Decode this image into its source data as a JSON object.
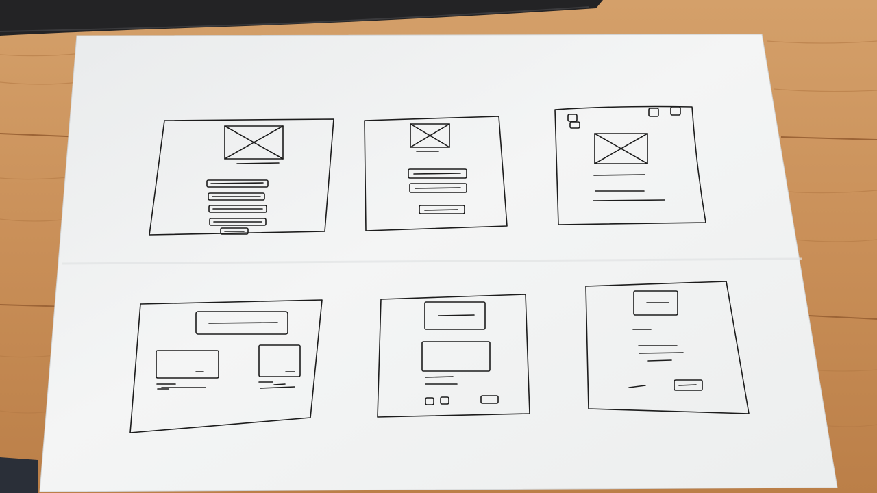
{
  "scene": {
    "subject": "",
    "colors": {
      "wood_light": "#d9a56e",
      "wood_mid": "#c88c55",
      "wood_dark": "#a86b3a",
      "laptop": "#232325",
      "paper": "#f2f3f3",
      "paper_shadow": "#dcdedf",
      "ink": "#1c1c1c"
    }
  },
  "wireframes": [
    {
      "id": 1,
      "elements": [
        "image-placeholder",
        "caption-line",
        "list-bar",
        "list-bar",
        "list-bar",
        "list-bar",
        "small-button"
      ]
    },
    {
      "id": 2,
      "elements": [
        "image-placeholder",
        "caption-line",
        "list-bar",
        "list-bar",
        "small-button"
      ]
    },
    {
      "id": 3,
      "elements": [
        "corner-icon",
        "corner-icon",
        "corner-icon",
        "image-placeholder",
        "text-line",
        "text-line",
        "text-line"
      ]
    },
    {
      "id": 4,
      "elements": [
        "header-bar",
        "card",
        "card",
        "text-line",
        "text-line"
      ]
    },
    {
      "id": 5,
      "elements": [
        "header-box",
        "content-box",
        "text-line",
        "text-line",
        "small-icon",
        "small-icon",
        "small-button"
      ]
    },
    {
      "id": 6,
      "elements": [
        "header-box",
        "text-line",
        "text-line",
        "text-line",
        "text-line",
        "small-button"
      ]
    }
  ]
}
